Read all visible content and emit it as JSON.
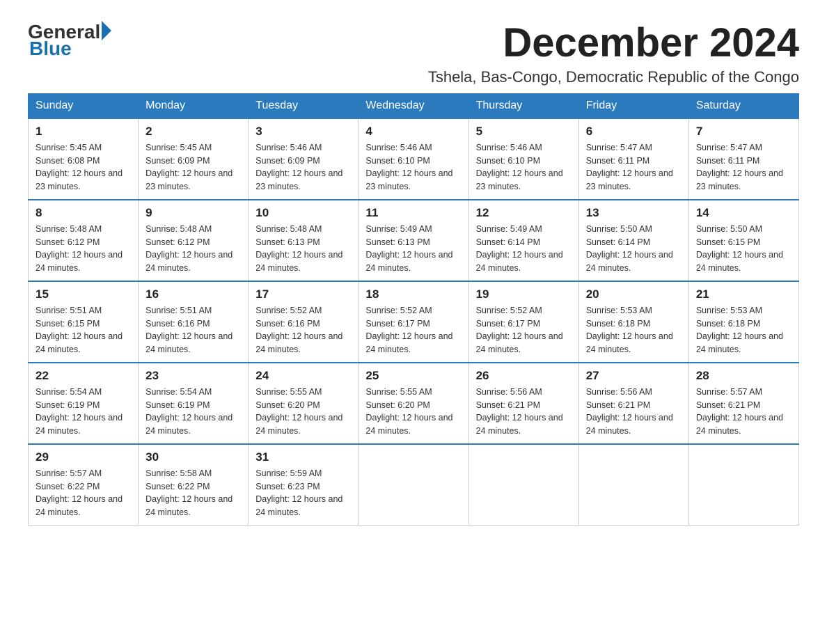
{
  "logo": {
    "general": "General",
    "arrow": "▶",
    "blue": "Blue"
  },
  "title": {
    "month_year": "December 2024",
    "location": "Tshela, Bas-Congo, Democratic Republic of the Congo"
  },
  "weekdays": [
    "Sunday",
    "Monday",
    "Tuesday",
    "Wednesday",
    "Thursday",
    "Friday",
    "Saturday"
  ],
  "weeks": [
    [
      {
        "day": "1",
        "sunrise": "5:45 AM",
        "sunset": "6:08 PM",
        "daylight": "12 hours and 23 minutes."
      },
      {
        "day": "2",
        "sunrise": "5:45 AM",
        "sunset": "6:09 PM",
        "daylight": "12 hours and 23 minutes."
      },
      {
        "day": "3",
        "sunrise": "5:46 AM",
        "sunset": "6:09 PM",
        "daylight": "12 hours and 23 minutes."
      },
      {
        "day": "4",
        "sunrise": "5:46 AM",
        "sunset": "6:10 PM",
        "daylight": "12 hours and 23 minutes."
      },
      {
        "day": "5",
        "sunrise": "5:46 AM",
        "sunset": "6:10 PM",
        "daylight": "12 hours and 23 minutes."
      },
      {
        "day": "6",
        "sunrise": "5:47 AM",
        "sunset": "6:11 PM",
        "daylight": "12 hours and 23 minutes."
      },
      {
        "day": "7",
        "sunrise": "5:47 AM",
        "sunset": "6:11 PM",
        "daylight": "12 hours and 23 minutes."
      }
    ],
    [
      {
        "day": "8",
        "sunrise": "5:48 AM",
        "sunset": "6:12 PM",
        "daylight": "12 hours and 24 minutes."
      },
      {
        "day": "9",
        "sunrise": "5:48 AM",
        "sunset": "6:12 PM",
        "daylight": "12 hours and 24 minutes."
      },
      {
        "day": "10",
        "sunrise": "5:48 AM",
        "sunset": "6:13 PM",
        "daylight": "12 hours and 24 minutes."
      },
      {
        "day": "11",
        "sunrise": "5:49 AM",
        "sunset": "6:13 PM",
        "daylight": "12 hours and 24 minutes."
      },
      {
        "day": "12",
        "sunrise": "5:49 AM",
        "sunset": "6:14 PM",
        "daylight": "12 hours and 24 minutes."
      },
      {
        "day": "13",
        "sunrise": "5:50 AM",
        "sunset": "6:14 PM",
        "daylight": "12 hours and 24 minutes."
      },
      {
        "day": "14",
        "sunrise": "5:50 AM",
        "sunset": "6:15 PM",
        "daylight": "12 hours and 24 minutes."
      }
    ],
    [
      {
        "day": "15",
        "sunrise": "5:51 AM",
        "sunset": "6:15 PM",
        "daylight": "12 hours and 24 minutes."
      },
      {
        "day": "16",
        "sunrise": "5:51 AM",
        "sunset": "6:16 PM",
        "daylight": "12 hours and 24 minutes."
      },
      {
        "day": "17",
        "sunrise": "5:52 AM",
        "sunset": "6:16 PM",
        "daylight": "12 hours and 24 minutes."
      },
      {
        "day": "18",
        "sunrise": "5:52 AM",
        "sunset": "6:17 PM",
        "daylight": "12 hours and 24 minutes."
      },
      {
        "day": "19",
        "sunrise": "5:52 AM",
        "sunset": "6:17 PM",
        "daylight": "12 hours and 24 minutes."
      },
      {
        "day": "20",
        "sunrise": "5:53 AM",
        "sunset": "6:18 PM",
        "daylight": "12 hours and 24 minutes."
      },
      {
        "day": "21",
        "sunrise": "5:53 AM",
        "sunset": "6:18 PM",
        "daylight": "12 hours and 24 minutes."
      }
    ],
    [
      {
        "day": "22",
        "sunrise": "5:54 AM",
        "sunset": "6:19 PM",
        "daylight": "12 hours and 24 minutes."
      },
      {
        "day": "23",
        "sunrise": "5:54 AM",
        "sunset": "6:19 PM",
        "daylight": "12 hours and 24 minutes."
      },
      {
        "day": "24",
        "sunrise": "5:55 AM",
        "sunset": "6:20 PM",
        "daylight": "12 hours and 24 minutes."
      },
      {
        "day": "25",
        "sunrise": "5:55 AM",
        "sunset": "6:20 PM",
        "daylight": "12 hours and 24 minutes."
      },
      {
        "day": "26",
        "sunrise": "5:56 AM",
        "sunset": "6:21 PM",
        "daylight": "12 hours and 24 minutes."
      },
      {
        "day": "27",
        "sunrise": "5:56 AM",
        "sunset": "6:21 PM",
        "daylight": "12 hours and 24 minutes."
      },
      {
        "day": "28",
        "sunrise": "5:57 AM",
        "sunset": "6:21 PM",
        "daylight": "12 hours and 24 minutes."
      }
    ],
    [
      {
        "day": "29",
        "sunrise": "5:57 AM",
        "sunset": "6:22 PM",
        "daylight": "12 hours and 24 minutes."
      },
      {
        "day": "30",
        "sunrise": "5:58 AM",
        "sunset": "6:22 PM",
        "daylight": "12 hours and 24 minutes."
      },
      {
        "day": "31",
        "sunrise": "5:59 AM",
        "sunset": "6:23 PM",
        "daylight": "12 hours and 24 minutes."
      },
      null,
      null,
      null,
      null
    ]
  ]
}
